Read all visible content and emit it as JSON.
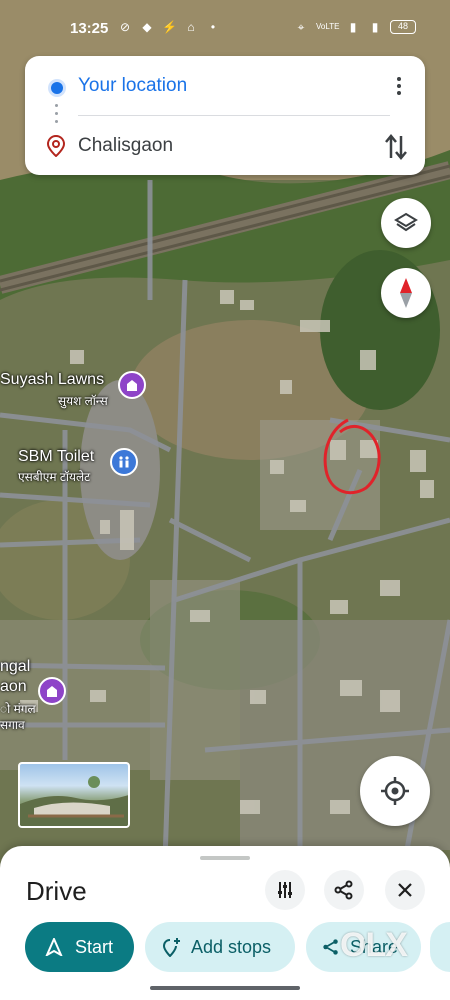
{
  "status_bar": {
    "time": "13:25",
    "battery": "48",
    "network": "VoLTE 4G"
  },
  "directions": {
    "origin": "Your location",
    "destination": "Chalisgaon",
    "origin_color": "#1a73e8",
    "destination_pin_color": "#b3261e"
  },
  "map": {
    "labels": [
      {
        "name": "Suyash Lawns",
        "sub": "सुयश लॉन्स"
      },
      {
        "name": "SBM Toilet",
        "sub": "एसबीएम टॉयलेट"
      },
      {
        "name": "ngal",
        "sub": "aon"
      },
      {
        "name": "",
        "sub": "ो मंगल"
      },
      {
        "name": "",
        "sub": "सगाव"
      }
    ],
    "controls": [
      "layers-icon",
      "compass-icon",
      "my-location-icon"
    ]
  },
  "sheet": {
    "title": "Drive",
    "buttons": {
      "start": "Start",
      "add_stops": "Add stops",
      "share": "Share"
    },
    "accent": "#0b7b83",
    "chip_bg": "#d5f0f3"
  },
  "watermark": "OLX"
}
